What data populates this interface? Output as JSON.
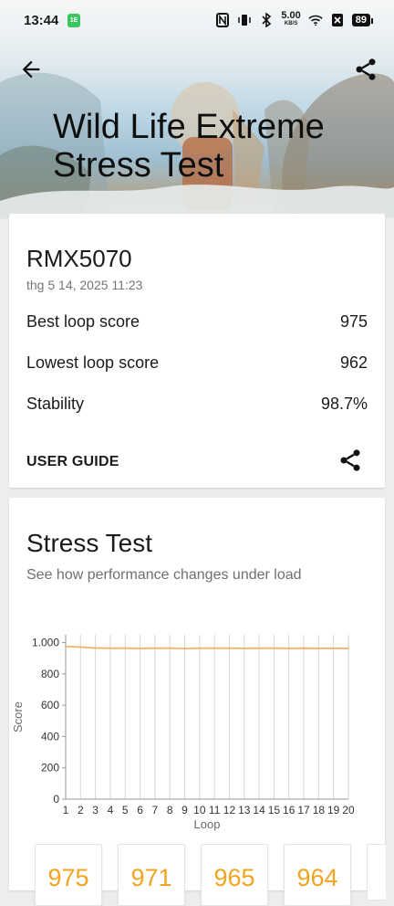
{
  "status_bar": {
    "time": "13:44",
    "app_badge": "1E",
    "speed_value": "5.00",
    "speed_unit": "KB/S",
    "battery": "89"
  },
  "header": {
    "title": "Wild Life Extreme Stress Test",
    "back_icon": "arrow-left-icon",
    "share_icon": "share-icon"
  },
  "summary": {
    "device": "RMX5070",
    "date": "thg 5 14, 2025 11:23",
    "best_label": "Best loop score",
    "best_value": "975",
    "lowest_label": "Lowest loop score",
    "lowest_value": "962",
    "stability_label": "Stability",
    "stability_value": "98.7%",
    "guide_label": "USER GUIDE"
  },
  "stress": {
    "title": "Stress Test",
    "subtitle": "See how performance changes under load",
    "loop_scores": [
      "975",
      "971",
      "965",
      "964"
    ]
  },
  "chart_data": {
    "type": "line",
    "xlabel": "Loop",
    "ylabel": "Score",
    "x": [
      1,
      2,
      3,
      4,
      5,
      6,
      7,
      8,
      9,
      10,
      11,
      12,
      13,
      14,
      15,
      16,
      17,
      18,
      19,
      20
    ],
    "series": [
      {
        "values": [
          975,
          971,
          965,
          964,
          964,
          963,
          964,
          965,
          962,
          965,
          964,
          964,
          963,
          964,
          964,
          963,
          964,
          963,
          963,
          963
        ]
      }
    ],
    "ylim": [
      0,
      1050
    ],
    "yticks": [
      "0",
      "200",
      "400",
      "600",
      "800",
      "1.000"
    ],
    "ytick_values": [
      0,
      200,
      400,
      600,
      800,
      1000
    ],
    "grid": "vertical",
    "line_color": "#f2b06b"
  },
  "colors": {
    "accent": "#f2a41f",
    "background": "#eceded"
  }
}
